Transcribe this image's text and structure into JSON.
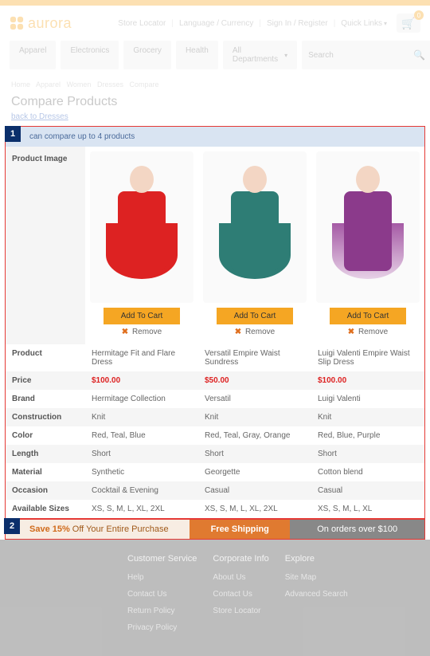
{
  "brand": "aurora",
  "header_links": {
    "store_locator": "Store Locator",
    "lang": "Language / Currency",
    "signin": "Sign In / Register",
    "quick": "Quick Links"
  },
  "cart_count": "0",
  "nav": {
    "apparel": "Apparel",
    "electronics": "Electronics",
    "grocery": "Grocery",
    "health": "Health",
    "all": "All Departments"
  },
  "search_placeholder": "Search",
  "breadcrumb": [
    "Home",
    "Apparel",
    "Women",
    "Dresses",
    "Compare"
  ],
  "page_title": "Compare Products",
  "back_link": "back to Dresses",
  "info_msg": "can compare up to 4 products",
  "callouts": {
    "one": "1",
    "two": "2"
  },
  "row_labels": {
    "image": "Product Image",
    "product": "Product",
    "price": "Price",
    "brand": "Brand",
    "construction": "Construction",
    "color": "Color",
    "length": "Length",
    "material": "Material",
    "occasion": "Occasion",
    "sizes": "Available Sizes"
  },
  "add_label": "Add To Cart",
  "remove_label": "Remove",
  "products": [
    {
      "name": "Hermitage Fit and Flare Dress",
      "price": "$100.00",
      "brand": "Hermitage Collection",
      "construction": "Knit",
      "color": "Red, Teal, Blue",
      "length": "Short",
      "material": "Synthetic",
      "occasion": "Cocktail & Evening",
      "sizes": "XS, S, M, L, XL, 2XL"
    },
    {
      "name": "Versatil Empire Waist Sundress",
      "price": "$50.00",
      "brand": "Versatil",
      "construction": "Knit",
      "color": "Red, Teal, Gray, Orange",
      "length": "Short",
      "material": "Georgette",
      "occasion": "Casual",
      "sizes": "XS, S, M, L, XL, 2XL"
    },
    {
      "name": "Luigi Valenti Empire Waist Slip Dress",
      "price": "$100.00",
      "brand": "Luigi Valenti",
      "construction": "Knit",
      "color": "Red, Blue, Purple",
      "length": "Short",
      "material": "Cotton blend",
      "occasion": "Casual",
      "sizes": "XS, S, M, L, XL"
    }
  ],
  "promo": {
    "save_bold": "Save 15%",
    "save_rest": " Off Your Entire Purchase",
    "free_ship": "Free Shipping",
    "on_orders": "On orders over $100"
  },
  "footer": {
    "cs_head": "Customer Service",
    "cs": [
      "Help",
      "Contact Us",
      "Return Policy",
      "Privacy Policy"
    ],
    "ci_head": "Corporate Info",
    "ci": [
      "About Us",
      "Contact Us",
      "Store Locator"
    ],
    "ex_head": "Explore",
    "ex": [
      "Site Map",
      "Advanced Search"
    ]
  }
}
